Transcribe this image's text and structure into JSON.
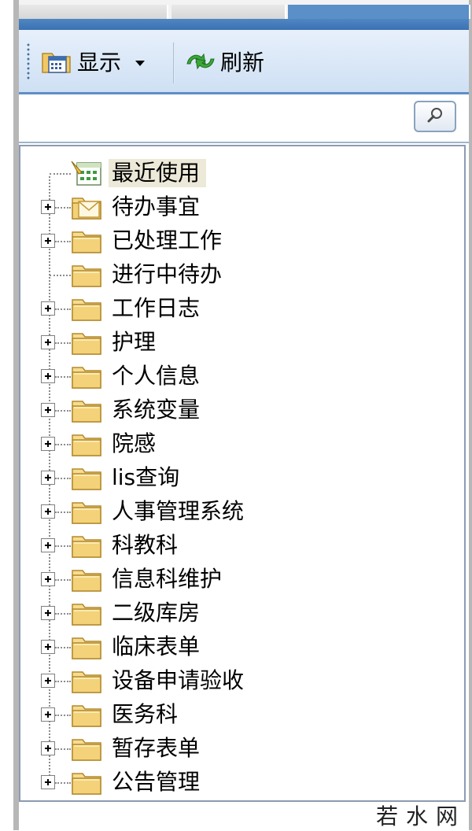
{
  "toolbar": {
    "show_label": "显示",
    "refresh_label": "刷新"
  },
  "search": {
    "value": "",
    "placeholder": ""
  },
  "tree": {
    "items": [
      {
        "label": "最近使用",
        "icon": "recent-icon",
        "expandable": false,
        "selected": true
      },
      {
        "label": "待办事宜",
        "icon": "mail-folder-icon",
        "expandable": true
      },
      {
        "label": "已处理工作",
        "icon": "folder-icon",
        "expandable": true
      },
      {
        "label": "进行中待办",
        "icon": "folder-icon",
        "expandable": false
      },
      {
        "label": "工作日志",
        "icon": "folder-icon",
        "expandable": true
      },
      {
        "label": "护理",
        "icon": "folder-icon",
        "expandable": true
      },
      {
        "label": "个人信息",
        "icon": "folder-icon",
        "expandable": true
      },
      {
        "label": "系统变量",
        "icon": "folder-icon",
        "expandable": true
      },
      {
        "label": "院感",
        "icon": "folder-icon",
        "expandable": true
      },
      {
        "label": "lis查询",
        "icon": "folder-icon",
        "expandable": true
      },
      {
        "label": "人事管理系统",
        "icon": "folder-icon",
        "expandable": true
      },
      {
        "label": "科教科",
        "icon": "folder-icon",
        "expandable": true
      },
      {
        "label": "信息科维护",
        "icon": "folder-icon",
        "expandable": true
      },
      {
        "label": "二级库房",
        "icon": "folder-icon",
        "expandable": true
      },
      {
        "label": "临床表单",
        "icon": "folder-icon",
        "expandable": true
      },
      {
        "label": "设备申请验收",
        "icon": "folder-icon",
        "expandable": true
      },
      {
        "label": "医务科",
        "icon": "folder-icon",
        "expandable": true
      },
      {
        "label": "暂存表单",
        "icon": "folder-icon",
        "expandable": true
      },
      {
        "label": "公告管理",
        "icon": "folder-icon",
        "expandable": true
      }
    ]
  },
  "watermark": "若水网",
  "colors": {
    "toolbar_top": "#e7f0fb",
    "toolbar_bottom": "#cfe0f4",
    "accent_blue": "#4f86c3",
    "folder": "#f3d27a",
    "selection": "#ece9d8"
  }
}
